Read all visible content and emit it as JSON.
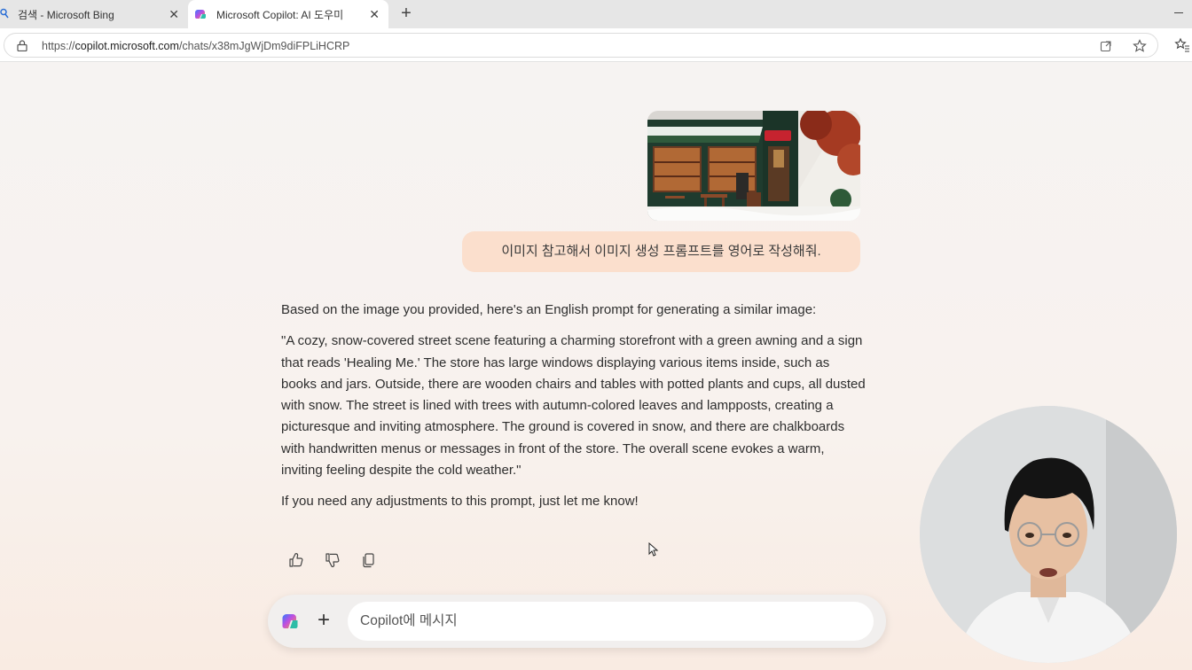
{
  "browser": {
    "tabs": [
      {
        "title": "검색 - Microsoft Bing",
        "active": false
      },
      {
        "title": "Microsoft Copilot: AI 도우미",
        "active": true
      }
    ],
    "url_prefix": "https://",
    "url_host": "copilot.microsoft.com",
    "url_path": "/chats/x38mJgWjDm9diFPLiHCRP"
  },
  "chat": {
    "user_message": "이미지 참고해서 이미지 생성 프롬프트를 영어로 작성해줘.",
    "assistant_paragraphs": [
      "Based on the image you provided, here's an English prompt for generating a similar image:",
      "\"A cozy, snow-covered street scene featuring a charming storefront with a green awning and a sign that reads 'Healing Me.' The store has large windows displaying various items inside, such as books and jars. Outside, there are wooden chairs and tables with potted plants and cups, all dusted with snow. The street is lined with trees with autumn-colored leaves and lampposts, creating a picturesque and inviting atmosphere. The ground is covered in snow, and there are chalkboards with handwritten menus or messages in front of the store. The overall scene evokes a warm, inviting feeling despite the cold weather.\"",
      "If you need any adjustments to this prompt, just let me know!"
    ]
  },
  "composer": {
    "placeholder": "Copilot에 메시지"
  },
  "icons": {
    "tab_favicons": [
      "search-icon",
      "copilot-icon"
    ],
    "reply_actions": [
      "thumbs-up-icon",
      "thumbs-down-icon",
      "copy-icon"
    ]
  },
  "colors": {
    "user_bubble": "#fbdfcd",
    "page_bg": "#f7f3f1",
    "awning_green": "#2f5a3c"
  }
}
